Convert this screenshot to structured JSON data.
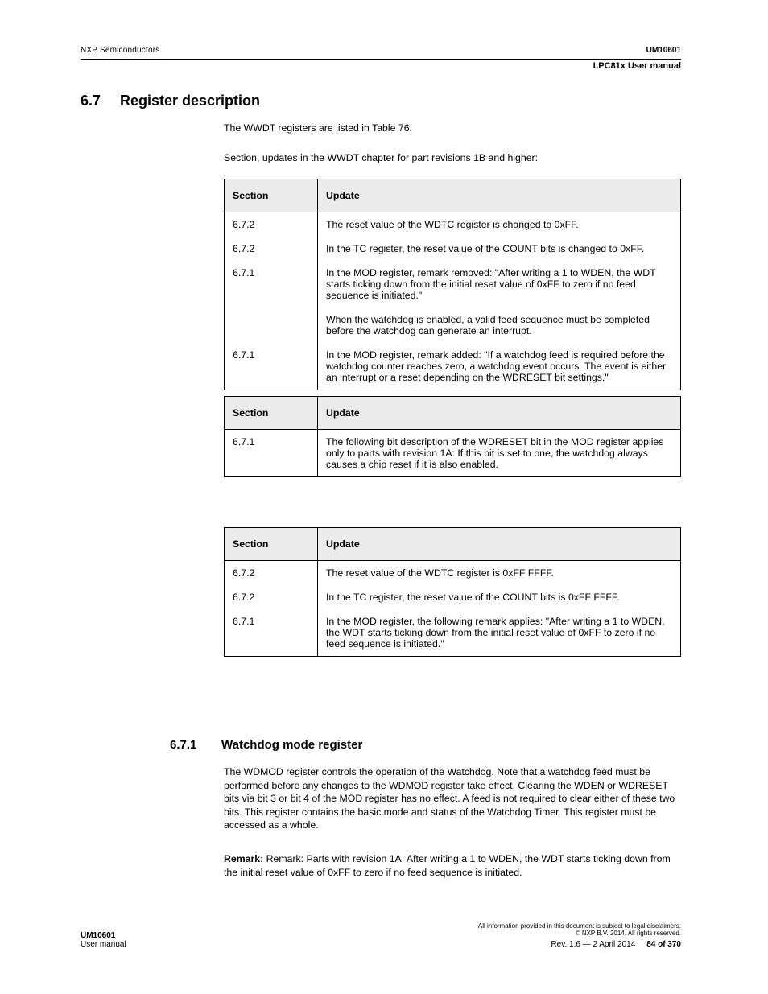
{
  "header": {
    "left": "UM10601",
    "right": "NXP Semiconductors",
    "subtitle": "LPC81x User manual"
  },
  "section": {
    "number": "6.7",
    "title": "Register description",
    "intro1": "The WWDT registers are listed in Table 76.",
    "intro2": "Section, updates in the WWDT chapter for part revisions 1B and higher:"
  },
  "tables": [
    {
      "header": [
        "Section",
        "Update"
      ],
      "rows": [
        [
          "6.7.2",
          "The reset value of the WDTC register is changed to 0xFF."
        ],
        [
          "6.7.2",
          "In the TC register, the reset value of the COUNT bits is changed to 0xFF."
        ],
        [
          "6.7.1",
          "In the MOD register, remark removed: \"After writing a 1 to WDEN, the WDT starts ticking down from the initial reset value of 0xFF to zero if no feed sequence is initiated.\""
        ],
        [
          "",
          "When the watchdog is enabled, a valid feed sequence must be completed before the watchdog can generate an interrupt."
        ],
        [
          "6.7.1",
          "In the MOD register, remark added: \"If a watchdog feed is required before the watchdog counter reaches zero, a watchdog event occurs. The event is either an interrupt or a reset depending on the WDRESET bit settings.\""
        ]
      ]
    },
    {
      "header": [
        "Section",
        "Update"
      ],
      "rows": [
        [
          "6.7.1",
          "The following bit description of the WDRESET bit in the MOD register applies only to parts with revision 1A: If this bit is set to one, the watchdog always causes a chip reset if it is also enabled."
        ]
      ]
    },
    {
      "header": [
        "Section",
        "Update"
      ],
      "rows": [
        [
          "6.7.2",
          "The reset value of the WDTC register is 0xFF FFFF."
        ],
        [
          "6.7.2",
          "In the TC register, the reset value of the COUNT bits is 0xFF FFFF."
        ],
        [
          "6.7.1",
          "In the MOD register, the following remark applies: \"After writing a 1 to WDEN, the WDT starts ticking down from the initial reset value of 0xFF to zero if no feed sequence is initiated.\""
        ]
      ]
    }
  ],
  "subsection": {
    "number": "6.7.1",
    "title": "Watchdog mode register",
    "para1": "The WDMOD register controls the operation of the Watchdog. Note that a watchdog feed must be performed before any changes to the WDMOD register take effect. Clearing the WDEN or WDRESET bits via bit 3 or bit 4 of the MOD register has no effect. A feed is not required to clear either of these two bits. This register contains the basic mode and status of the Watchdog Timer. This register must be accessed as a whole.",
    "para2": "Remark: Parts with revision 1A: After writing a 1 to WDEN, the WDT starts ticking down from the initial reset value of 0xFF to zero if no feed sequence is initiated."
  },
  "footer": {
    "left": "User manual",
    "right_line1": "All information provided in this document is subject to legal disclaimers.",
    "right_line2": "Rev. 1.6 — 2 April 2014",
    "copyright": "© NXP B.V. 2014. All rights reserved.",
    "page": "84 of 370"
  }
}
